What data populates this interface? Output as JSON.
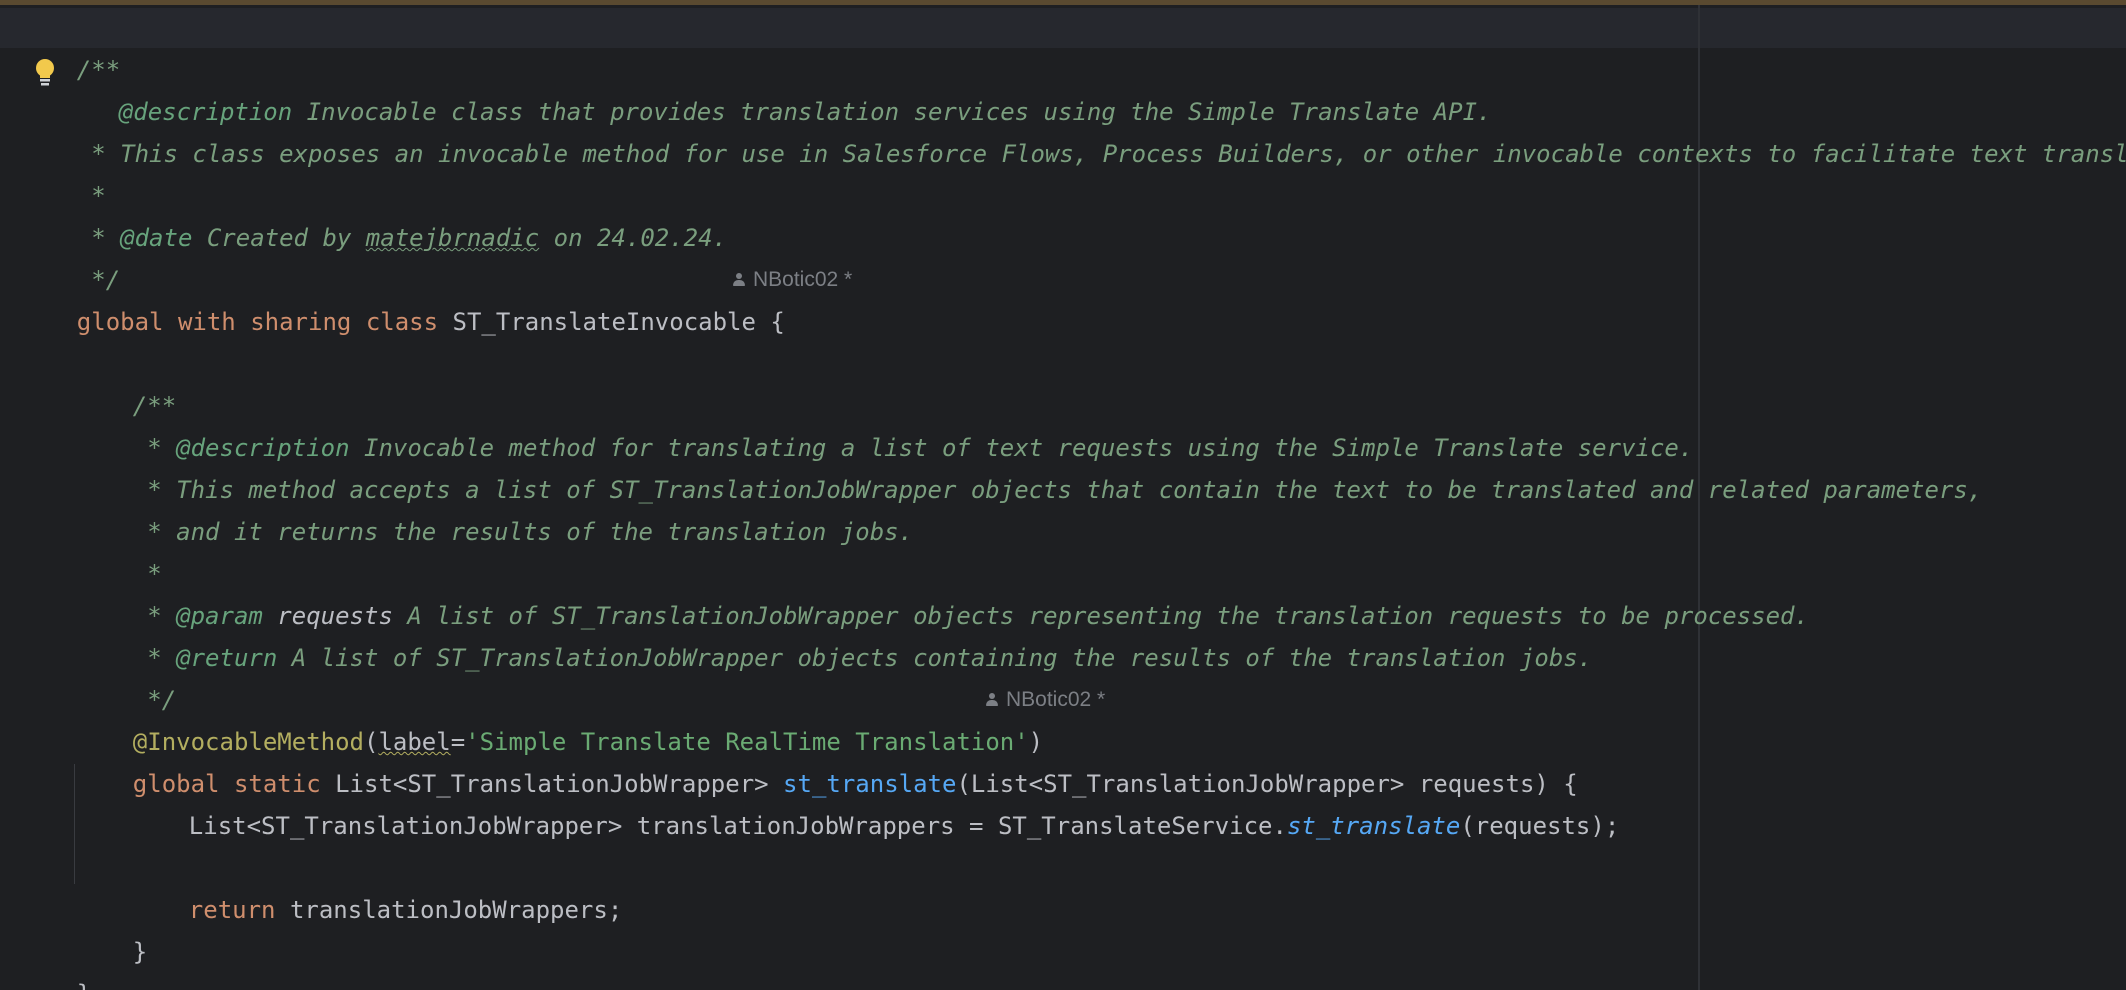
{
  "editor": {
    "doc_comment": {
      "open": "/**",
      "description_tag": "@description",
      "description_text": " Invocable class that provides translation services using the Simple Translate API.",
      "line2": " * This class exposes an invocable method for use in Salesforce Flows, Process Builders, or other invocable contexts to facilitate text translation.",
      "line3": " *",
      "date_prefix": " * ",
      "date_tag": "@date",
      "date_text_a": " Created by ",
      "date_author": "matejbrnadic",
      "date_text_b": " on 24.02.24.",
      "close": " */"
    },
    "class_decl": {
      "kw1": "global",
      "kw2": "with",
      "kw3": "sharing",
      "kw4": "class",
      "name": "ST_TranslateInvocable",
      "brace": "{",
      "author_hint": "NBotic02 *"
    },
    "method_comment": {
      "open": "/**",
      "desc_prefix": " * ",
      "desc_tag": "@description",
      "desc_text": " Invocable method for translating a list of text requests using the Simple Translate service.",
      "line2": " * This method accepts a list of ST_TranslationJobWrapper objects that contain the text to be translated and related parameters,",
      "line3": " * and it returns the results of the translation jobs.",
      "line4": " *",
      "param_prefix": " * ",
      "param_tag": "@param",
      "param_name": " requests",
      "param_text": " A list of ST_TranslationJobWrapper objects representing the translation requests to be processed.",
      "return_prefix": " * ",
      "return_tag": "@return",
      "return_text": " A list of ST_TranslationJobWrapper objects containing the results of the translation jobs.",
      "close": " */"
    },
    "annotation": {
      "name": "@InvocableMethod",
      "paren_open": "(",
      "param": "label",
      "eq": "=",
      "value": "'Simple Translate RealTime Translation'",
      "paren_close": ")",
      "author_hint": "NBotic02 *"
    },
    "method_decl": {
      "kw1": "global",
      "kw2": "static",
      "return_type": "List<ST_TranslationJobWrapper>",
      "name": "st_translate",
      "params": "(List<ST_TranslationJobWrapper> requests) {"
    },
    "body_line1": {
      "decl": "List<ST_TranslationJobWrapper> translationJobWrappers = ST_TranslateService.",
      "call": "st_translate",
      "args": "(requests);"
    },
    "body_line2": {
      "kw": "return",
      "value": " translationJobWrappers;"
    },
    "method_close": "}",
    "class_close": "}"
  },
  "colors": {
    "background": "#1e1f22",
    "comment": "#7a9e7e",
    "keyword": "#cf8e6d",
    "method": "#56a8f5",
    "annotation": "#b3ae60",
    "string": "#6aab73",
    "bulb": "#f2c94c"
  },
  "icons": {
    "gutter": "lightbulb-icon",
    "author": "user-icon"
  }
}
